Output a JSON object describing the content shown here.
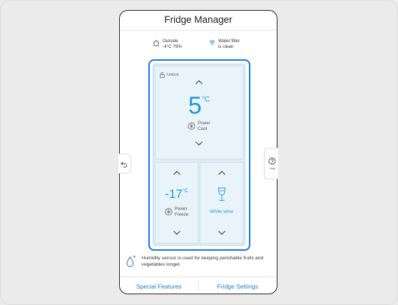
{
  "header": {
    "title": "Fridge Manager"
  },
  "status": {
    "outside_label": "Outside",
    "outside_value": "-4°C  79%",
    "filter_line1": "Water filter",
    "filter_line2": "is clean"
  },
  "fridge": {
    "lock_label": "Unlock",
    "top": {
      "temperature": "5",
      "unit": "°C",
      "mode_line1": "Power",
      "mode_line2": "Cool"
    },
    "bottom_left": {
      "temperature": "-17",
      "unit": "°C",
      "mode_line1": "Power",
      "mode_line2": "Freeze"
    },
    "bottom_right": {
      "mode_label": "White wine"
    }
  },
  "side": {
    "help_label": "Help"
  },
  "humidity": {
    "text": "Humidity sensor is used for keeping perishable fruits and vegetables longer."
  },
  "tabs": {
    "special": "Special Features",
    "settings": "Fridge Settings"
  },
  "colors": {
    "accent_blue": "#1473e6",
    "temp_blue": "#1f9ad6",
    "link_blue": "#1f7fc0"
  }
}
